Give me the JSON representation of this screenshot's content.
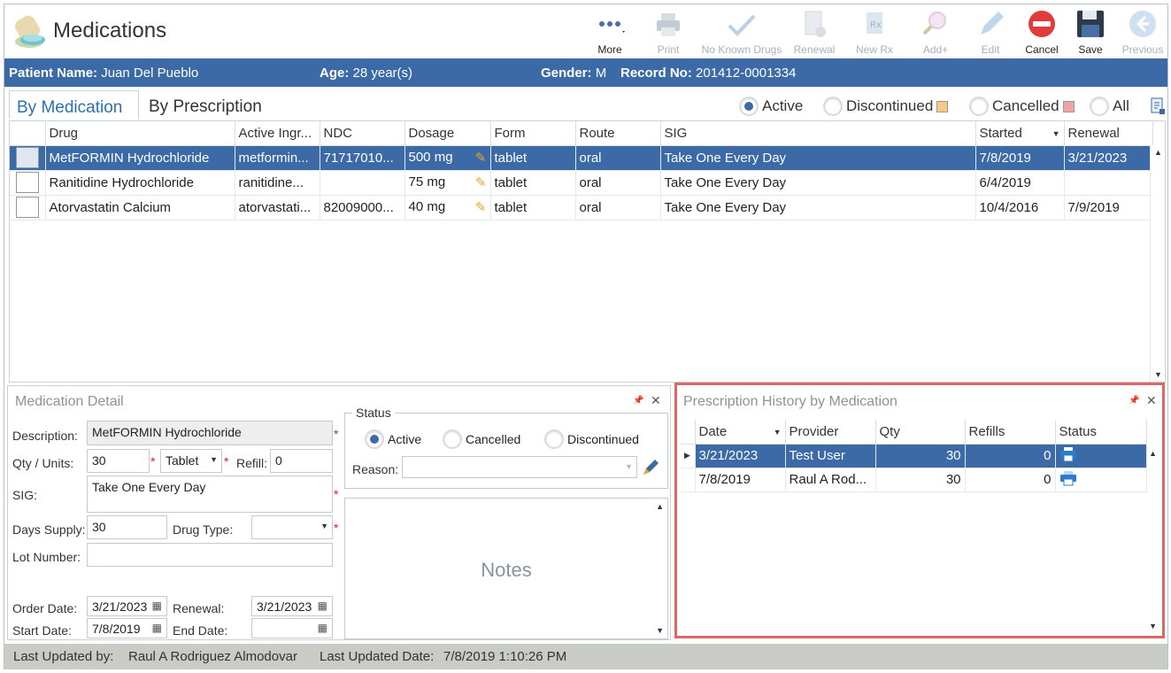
{
  "app": {
    "title": "Medications"
  },
  "toolbar": {
    "more": "More",
    "print": "Print",
    "no_known_drugs": "No Known Drugs",
    "renewal": "Renewal",
    "new_rx": "New Rx",
    "add": "Add+",
    "edit": "Edit",
    "cancel": "Cancel",
    "save": "Save",
    "previous": "Previous"
  },
  "patient": {
    "name_label": "Patient Name:",
    "name": "Juan Del Pueblo",
    "age_label": "Age:",
    "age": "28 year(s)",
    "gender_label": "Gender:",
    "gender": "M",
    "record_label": "Record No:",
    "record": "201412-0001334"
  },
  "tabs": [
    {
      "label": "By Medication",
      "active": true
    },
    {
      "label": "By Prescription",
      "active": false
    }
  ],
  "filters": {
    "active": "Active",
    "discontinued": "Discontinued",
    "cancelled": "Cancelled",
    "all": "All",
    "selected": "Active",
    "discontinued_color": "#f6c984",
    "cancelled_color": "#f2a3a3"
  },
  "grid": {
    "columns": [
      "Drug",
      "Active Ingr...",
      "NDC",
      "Dosage",
      "Form",
      "Route",
      "SIG",
      "Started",
      "Renewal"
    ],
    "rows": [
      {
        "drug": "MetFORMIN Hydrochloride",
        "ingredient": "metformin...",
        "ndc": "71717010...",
        "dosage": "500 mg",
        "form": "tablet",
        "route": "oral",
        "sig": "Take One Every Day",
        "started": "7/8/2019",
        "renewal": "3/21/2023",
        "selected": true
      },
      {
        "drug": "Ranitidine Hydrochloride",
        "ingredient": "ranitidine...",
        "ndc": "",
        "dosage": "75 mg",
        "form": "tablet",
        "route": "oral",
        "sig": "Take One Every Day",
        "started": "6/4/2019",
        "renewal": "",
        "selected": false
      },
      {
        "drug": "Atorvastatin Calcium",
        "ingredient": "atorvastati...",
        "ndc": "82009000...",
        "dosage": "40 mg",
        "form": "tablet",
        "route": "oral",
        "sig": "Take One Every Day",
        "started": "10/4/2016",
        "renewal": "7/9/2019",
        "selected": false
      }
    ]
  },
  "detail": {
    "title": "Medication Detail",
    "description_label": "Description:",
    "description": "MetFORMIN Hydrochloride",
    "qty_label": "Qty / Units:",
    "qty": "30",
    "unit": "Tablet",
    "refill_label": "Refill:",
    "refill": "0",
    "sig_label": "SIG:",
    "sig": "Take One Every Day",
    "days_supply_label": "Days Supply:",
    "days_supply": "30",
    "drug_type_label": "Drug Type:",
    "drug_type": "",
    "lot_label": "Lot Number:",
    "lot": "",
    "order_date_label": "Order Date:",
    "order_date": "3/21/2023",
    "renewal_label": "Renewal:",
    "renewal": "3/21/2023",
    "start_date_label": "Start Date:",
    "start_date": "7/8/2019",
    "end_date_label": "End Date:",
    "end_date": "",
    "status_legend": "Status",
    "status_active": "Active",
    "status_cancelled": "Cancelled",
    "status_discontinued": "Discontinued",
    "reason_label": "Reason:",
    "reason": "",
    "notes_label": "Notes"
  },
  "history": {
    "title": "Prescription History by Medication",
    "columns": [
      "Date",
      "Provider",
      "Qty",
      "Refills",
      "Status"
    ],
    "rows": [
      {
        "date": "3/21/2023",
        "provider": "Test User",
        "qty": "30",
        "refills": "0",
        "status_icon": "printer-icon",
        "selected": true
      },
      {
        "date": "7/8/2019",
        "provider": "Raul A Rod...",
        "qty": "30",
        "refills": "0",
        "status_icon": "printer-icon",
        "selected": false
      }
    ]
  },
  "footer": {
    "updated_by_label": "Last Updated by:",
    "updated_by": "Raul A Rodriguez Almodovar",
    "updated_date_label": "Last Updated Date:",
    "updated_date": "7/8/2019 1:10:26 PM"
  },
  "colors": {
    "accent": "#3b6aa6",
    "highlight_border": "#e06666",
    "required": "#e02020"
  }
}
